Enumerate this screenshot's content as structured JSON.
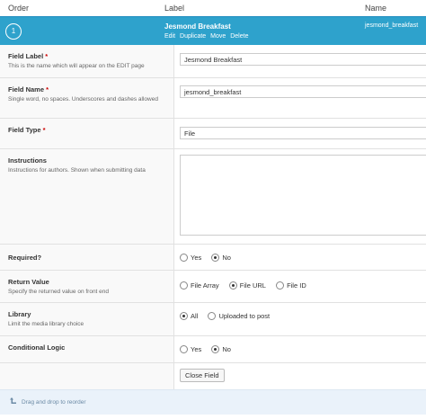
{
  "columns": {
    "order": "Order",
    "label": "Label",
    "name": "Name"
  },
  "field": {
    "order": "1",
    "title": "Jesmond Breakfast",
    "actions": [
      "Edit",
      "Duplicate",
      "Move",
      "Delete"
    ],
    "name": "jesmond_breakfast"
  },
  "settings": {
    "field_label": {
      "title": "Field Label",
      "desc": "This is the name which will appear on the EDIT page",
      "value": "Jesmond Breakfast"
    },
    "field_name": {
      "title": "Field Name",
      "desc": "Single word, no spaces. Underscores and dashes allowed",
      "value": "jesmond_breakfast"
    },
    "field_type": {
      "title": "Field Type",
      "value": "File"
    },
    "instructions": {
      "title": "Instructions",
      "desc": "Instructions for authors. Shown when submitting data",
      "value": ""
    },
    "required": {
      "title": "Required?",
      "options": [
        "Yes",
        "No"
      ],
      "selected": "No"
    },
    "return_value": {
      "title": "Return Value",
      "desc": "Specify the returned value on front end",
      "options": [
        "File Array",
        "File URL",
        "File ID"
      ],
      "selected": "File URL"
    },
    "library": {
      "title": "Library",
      "desc": "Limit the media library choice",
      "options": [
        "All",
        "Uploaded to post"
      ],
      "selected": "All"
    },
    "conditional_logic": {
      "title": "Conditional Logic",
      "options": [
        "Yes",
        "No"
      ],
      "selected": "No"
    },
    "close_button": "Close Field"
  },
  "footer": {
    "text": "Drag and drop to reorder",
    "icon": "reorder-arrow-icon"
  },
  "required_marker": "*",
  "colors": {
    "field_bar": "#2ea2cc",
    "footer_bg": "#eaf2fa",
    "required": "#cc0000"
  }
}
